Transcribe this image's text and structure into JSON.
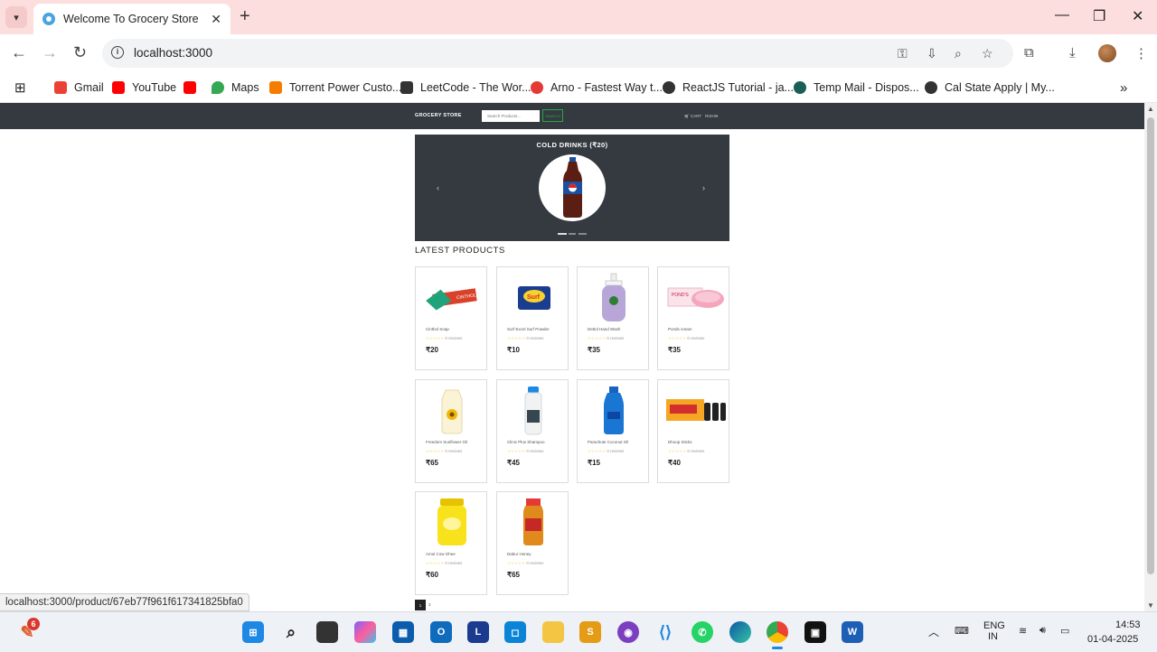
{
  "browser": {
    "tab_title": "Welcome To Grocery Store",
    "tab_close": "✕",
    "new_tab": "+",
    "url": "localhost:3000",
    "status_url": "localhost:3000/product/67eb77f961f617341825bfa0",
    "bookmarks": [
      {
        "label": "Gmail",
        "color": "#ea4335"
      },
      {
        "label": "YouTube",
        "color": "#ff0000"
      },
      {
        "label": "",
        "color": "#ff0000"
      },
      {
        "label": "Maps",
        "color": "#34a853"
      },
      {
        "label": "Torrent Power Custo...",
        "color": "#f57c00"
      },
      {
        "label": "LeetCode - The Wor...",
        "color": "#333333"
      },
      {
        "label": "Arno - Fastest Way t...",
        "color": "#e53935"
      },
      {
        "label": "ReactJS Tutorial - ja...",
        "color": "#333333"
      },
      {
        "label": "Temp Mail - Dispos...",
        "color": "#1b5e55"
      },
      {
        "label": "Cal State Apply | My...",
        "color": "#333333"
      }
    ]
  },
  "site": {
    "brand": "GROCERY STORE",
    "search_placeholder": "Search Products...",
    "search_button": "SEARCH",
    "cart_label": "CART",
    "user_label": "RISHI",
    "carousel": {
      "caption": "COLD DRINKS (₹20)"
    },
    "section_title": "LATEST PRODUCTS",
    "products": [
      {
        "name": "Cinthol Soap",
        "reviews": "0 reviews",
        "price": "₹20",
        "rating": 0
      },
      {
        "name": "Surf Excel Surf Powder",
        "reviews": "0 reviews",
        "price": "₹10",
        "rating": 0
      },
      {
        "name": "Dettol Hand Wash",
        "reviews": "0 reviews",
        "price": "₹35",
        "rating": 0
      },
      {
        "name": "Ponds cream",
        "reviews": "0 reviews",
        "price": "₹35",
        "rating": 0
      },
      {
        "name": "Freedom Sunflower Oil",
        "reviews": "0 reviews",
        "price": "₹65",
        "rating": 0
      },
      {
        "name": "Clinic Plus Shampoo",
        "reviews": "0 reviews",
        "price": "₹45",
        "rating": 0
      },
      {
        "name": "Parachute Coconut Oil",
        "reviews": "0 reviews",
        "price": "₹15",
        "rating": 0
      },
      {
        "name": "Dhoop Sticks",
        "reviews": "0 reviews",
        "price": "₹40",
        "rating": 0
      },
      {
        "name": "Amul Cow Ghee",
        "reviews": "0 reviews",
        "price": "₹60",
        "rating": 0
      },
      {
        "name": "Dabur Honey",
        "reviews": "0 reviews",
        "price": "₹65",
        "rating": 0
      }
    ],
    "pagination": [
      "1",
      "2"
    ]
  },
  "taskbar": {
    "notification_count": "6",
    "lang_top": "ENG",
    "lang_bottom": "IN",
    "time": "14:53",
    "date": "01-04-2025",
    "outlook_badge": "1"
  }
}
